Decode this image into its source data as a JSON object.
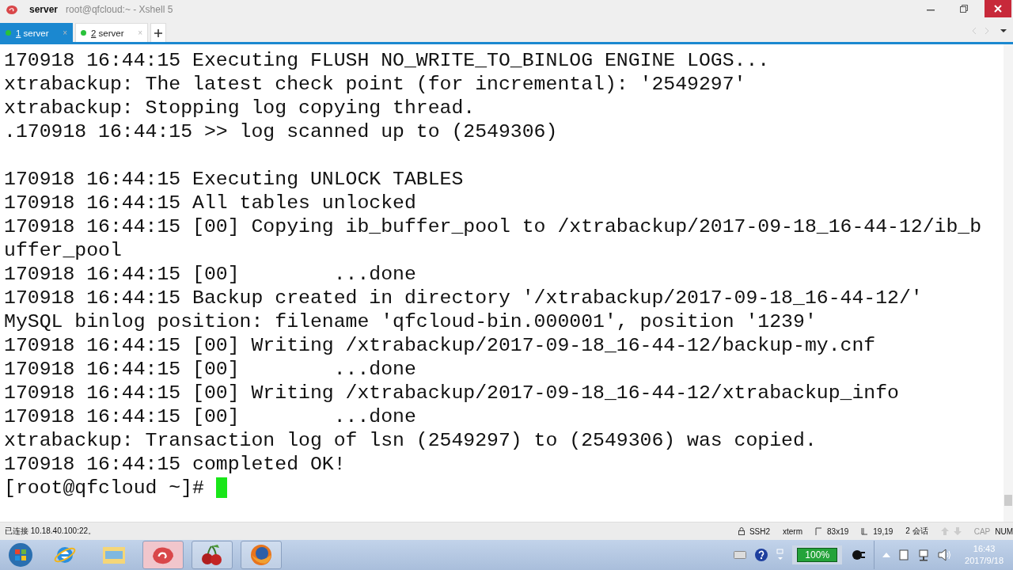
{
  "window": {
    "title": "server",
    "subtitle": "root@qfcloud:~ - Xshell 5"
  },
  "tabs": [
    {
      "number": "1",
      "label": " server",
      "close": "×",
      "selected": true
    },
    {
      "number": "2",
      "label": " server",
      "close": "×",
      "selected": false
    }
  ],
  "terminal": {
    "blocks": [
      {
        "lines": [
          "170918 16:44:15 Executing FLUSH NO_WRITE_TO_BINLOG ENGINE LOGS...",
          "xtrabackup: The latest check point (for incremental): '2549297'",
          "xtrabackup: Stopping log copying thread.",
          ".170918 16:44:15 >> log scanned up to (2549306)"
        ]
      },
      {
        "lines": [
          "170918 16:44:15 Executing UNLOCK TABLES",
          "170918 16:44:15 All tables unlocked",
          "170918 16:44:15 [00] Copying ib_buffer_pool to /xtrabackup/2017-09-18_16-44-12/ib_b",
          "uffer_pool",
          "170918 16:44:15 [00]        ...done",
          "170918 16:44:15 Backup created in directory '/xtrabackup/2017-09-18_16-44-12/'",
          "MySQL binlog position: filename 'qfcloud-bin.000001', position '1239'",
          "170918 16:44:15 [00] Writing /xtrabackup/2017-09-18_16-44-12/backup-my.cnf",
          "170918 16:44:15 [00]        ...done",
          "170918 16:44:15 [00] Writing /xtrabackup/2017-09-18_16-44-12/xtrabackup_info",
          "170918 16:44:15 [00]        ...done",
          "xtrabackup: Transaction log of lsn (2549297) to (2549306) was copied.",
          "170918 16:44:15 completed OK!"
        ]
      }
    ],
    "prompt": "[root@qfcloud ~]# "
  },
  "status_bar": {
    "connection": "已连接 10.18.40.100:22。",
    "protocol": "SSH2",
    "terminal_type": "xterm",
    "size": "83x19",
    "cursor": "19,19",
    "sessions": "2 会话",
    "caps": "CAP",
    "num": "NUM"
  },
  "taskbar": {
    "battery": "100%",
    "time": "16:43",
    "date": "2017/9/18"
  }
}
